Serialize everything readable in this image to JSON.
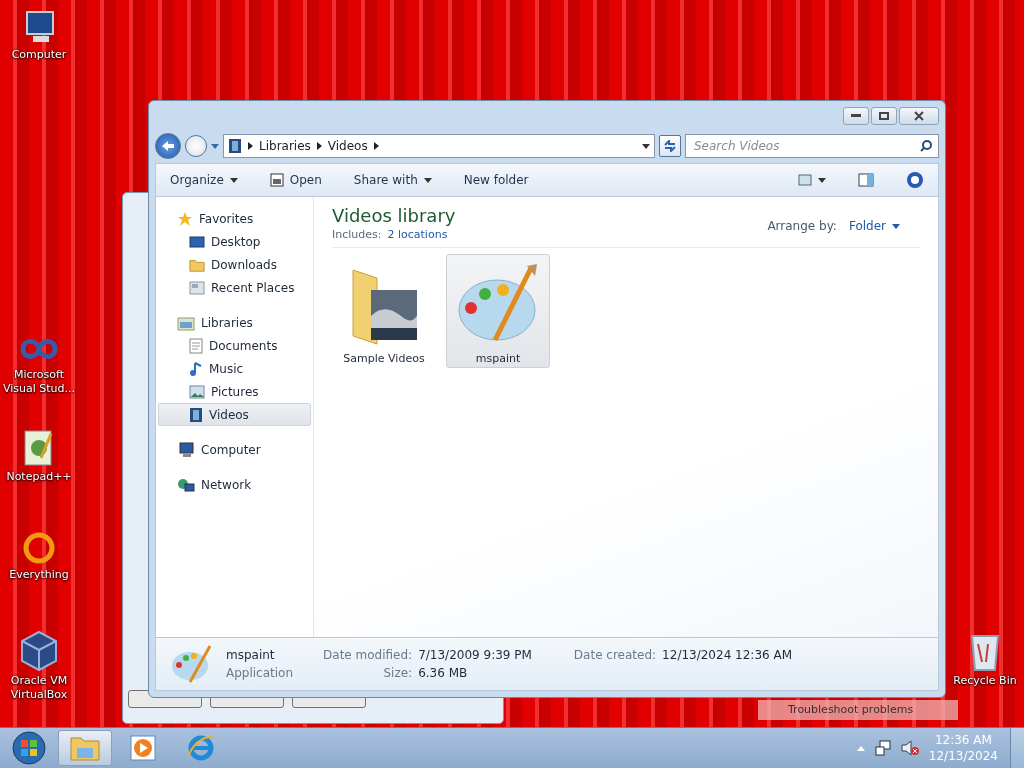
{
  "desktop_icons": [
    {
      "label": "Computer"
    },
    {
      "label": "Microsoft Visual Stud..."
    },
    {
      "label": "Notepad++"
    },
    {
      "label": "Everything"
    },
    {
      "label": "Oracle VM VirtualBox"
    },
    {
      "label": "Recycle Bin"
    }
  ],
  "window": {
    "address": [
      "Libraries",
      "Videos"
    ],
    "search": {
      "placeholder": "Search Videos"
    },
    "toolbar": [
      {
        "label": "Organize",
        "kind": "menu"
      },
      {
        "label": "Open",
        "kind": "icon"
      },
      {
        "label": "Share with",
        "kind": "menu"
      },
      {
        "label": "New folder",
        "kind": "plain"
      }
    ],
    "nav": [
      {
        "label": "Favorites",
        "selected": false,
        "children": [
          {
            "label": "Desktop",
            "selected": false
          },
          {
            "label": "Downloads",
            "selected": false
          },
          {
            "label": "Recent Places",
            "selected": false
          }
        ]
      },
      {
        "label": "Libraries",
        "selected": false,
        "children": [
          {
            "label": "Documents",
            "selected": false
          },
          {
            "label": "Music",
            "selected": false
          },
          {
            "label": "Pictures",
            "selected": false
          },
          {
            "label": "Videos",
            "selected": true
          }
        ]
      },
      {
        "label": "Computer",
        "selected": false
      },
      {
        "label": "Network",
        "selected": false
      }
    ],
    "library": {
      "title": "Videos library",
      "includes_label": "Includes:",
      "includes_link": "2 locations",
      "arrange_label": "Arrange by:",
      "arrange_value": "Folder"
    },
    "items": [
      {
        "label": "Sample Videos",
        "selected": false
      },
      {
        "label": "mspaint",
        "selected": true
      }
    ],
    "details": {
      "name": "mspaint",
      "type": "Application",
      "fields": [
        {
          "label": "Date modified:",
          "value": "7/13/2009 9:39 PM"
        },
        {
          "label": "Size:",
          "value": "6.36 MB"
        },
        {
          "label": "Date created:",
          "value": "12/13/2024 12:36 AM"
        }
      ]
    }
  },
  "tooltip": "Troubleshoot problems",
  "taskbar": {
    "apps": [
      {
        "active": true
      },
      {
        "active": false
      },
      {
        "active": false
      }
    ],
    "time": "12:36 AM",
    "date": "12/13/2024"
  }
}
